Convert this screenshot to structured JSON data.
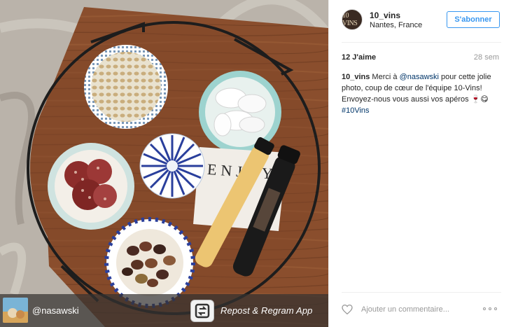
{
  "post": {
    "username": "10_vins",
    "location": "Nantes, France",
    "avatar_text": "10 VINS",
    "follow_label": "S'abonner",
    "likes": "12 J'aime",
    "age": "28 sem",
    "caption": {
      "user": "10_vins",
      "part1": " Merci à ",
      "mention": "@nasawski",
      "part2": " pour cette jolie photo, coup de cœur de l'équipe 10-Vins! Envoyez-nous vous aussi vos apéros 🍷😋",
      "hashtag": "#10Vins"
    },
    "comment_placeholder": "Ajouter un commentaire..."
  },
  "photo": {
    "regram_user": "@nasawski",
    "regram_app_label": "Repost & Regram App",
    "card_text": "ENJOY"
  },
  "colors": {
    "accent": "#3897f0",
    "link": "#003569",
    "muted": "#999999"
  },
  "icons": {
    "like": "heart-outline-icon",
    "more": "ellipsis-icon",
    "repost": "repost-icon"
  }
}
